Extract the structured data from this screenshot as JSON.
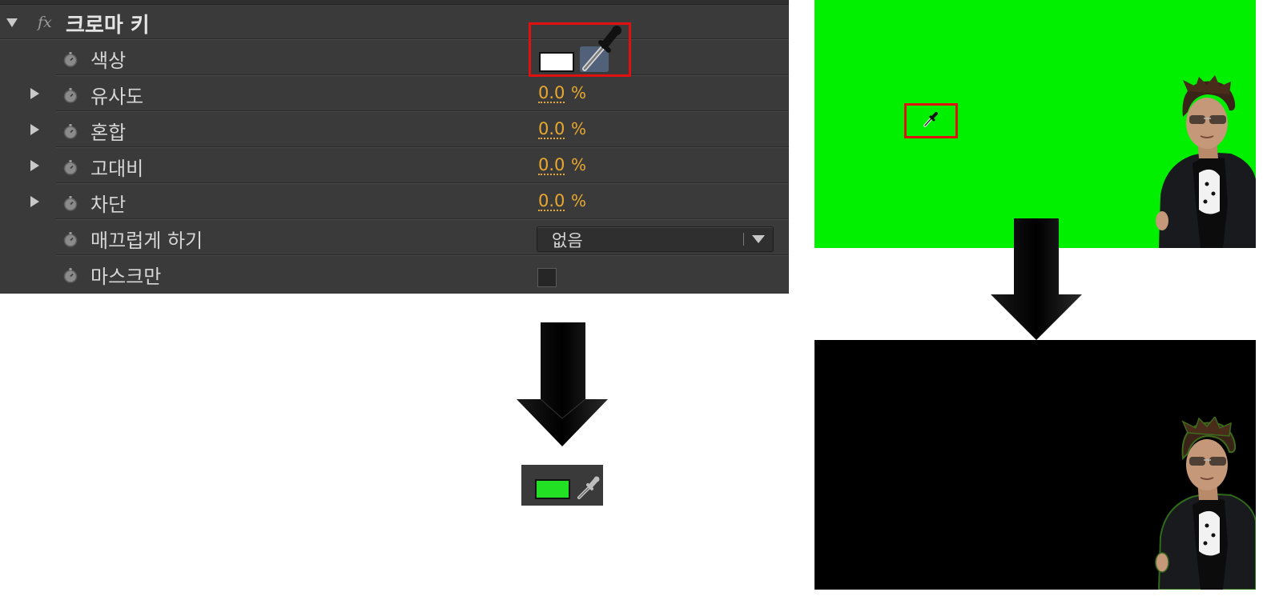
{
  "effect": {
    "fx_icon": "fx",
    "name": "크로마 키",
    "properties": [
      {
        "label": "색상",
        "type": "color",
        "color": "#ffffff"
      },
      {
        "label": "유사도",
        "type": "percent",
        "value": "0.0",
        "unit": "%"
      },
      {
        "label": "혼합",
        "type": "percent",
        "value": "0.0",
        "unit": "%"
      },
      {
        "label": "고대비",
        "type": "percent",
        "value": "0.0",
        "unit": "%"
      },
      {
        "label": "차단",
        "type": "percent",
        "value": "0.0",
        "unit": "%"
      },
      {
        "label": "매끄럽게 하기",
        "type": "dropdown",
        "selected": "없음"
      },
      {
        "label": "마스크만",
        "type": "checkbox",
        "checked": false
      }
    ]
  },
  "picked_color": {
    "color": "#22e024"
  },
  "colors": {
    "highlight": "#e01010",
    "value_text": "#e8a92e",
    "green_screen": "#00f000",
    "keyed_background": "#000000"
  },
  "icons": [
    "stopwatch-icon",
    "eyedropper-icon",
    "twirl-arrow-icon",
    "down-arrow-icon"
  ]
}
